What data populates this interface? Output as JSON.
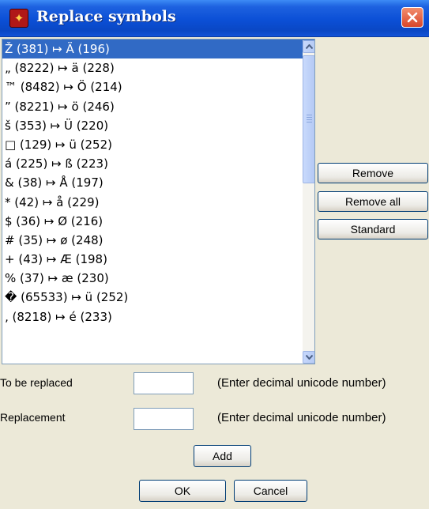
{
  "window": {
    "title": "Replace symbols",
    "icon": "app-icon",
    "close_icon": "close-icon"
  },
  "list": {
    "items": [
      "Ž (381) ↦ Ä (196)",
      "„ (8222) ↦ ä (228)",
      "™ (8482) ↦ Ö (214)",
      "” (8221) ↦ ö (246)",
      "š (353) ↦ Ü (220)",
      "□ (129) ↦ ü (252)",
      "á (225) ↦ ß (223)",
      "& (38) ↦ Å (197)",
      "* (42) ↦ å (229)",
      "$ (36) ↦ Ø (216)",
      "# (35) ↦ ø (248)",
      "+ (43) ↦ Æ (198)",
      "% (37) ↦ æ (230)",
      "� (65533) ↦ ü (252)",
      "‚ (8218) ↦ é (233)"
    ],
    "selected_index": 0,
    "scrollbar_position": 0.0
  },
  "side_buttons": {
    "remove": "Remove",
    "remove_all": "Remove all",
    "standard": "Standard"
  },
  "form": {
    "to_be_replaced_label": "To be replaced",
    "to_be_replaced_value": "",
    "replacement_label": "Replacement",
    "replacement_value": "",
    "hint": "(Enter decimal unicode number)",
    "add": "Add"
  },
  "footer": {
    "ok": "OK",
    "cancel": "Cancel"
  },
  "colors": {
    "titlebar": "#0b4fd6",
    "selection": "#316ac5",
    "dialog_bg": "#ece9d8"
  }
}
